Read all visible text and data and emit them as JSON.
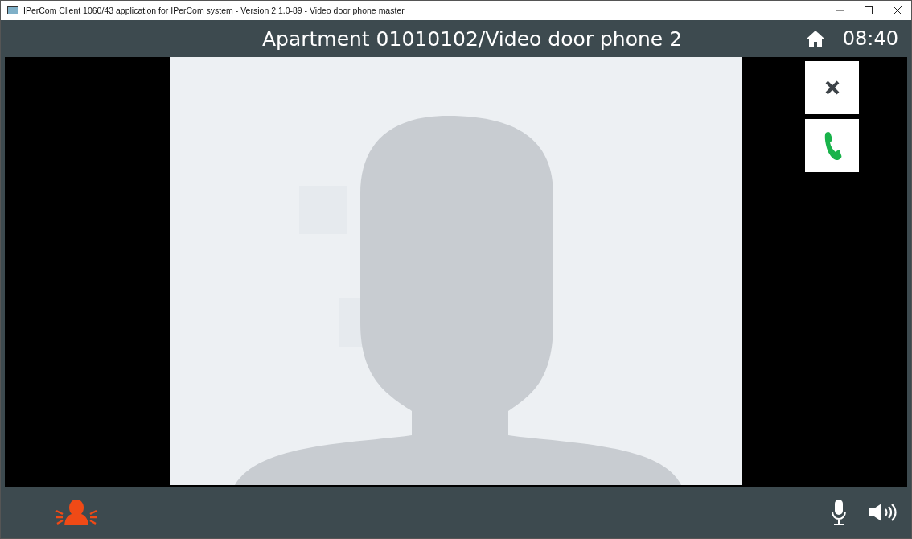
{
  "window": {
    "title": "IPerCom Client 1060/43 application for IPerCom system - Version 2.1.0-89 - Video door phone master"
  },
  "header": {
    "title": "Apartment 01010102/Video door phone 2",
    "clock": "08:40"
  }
}
